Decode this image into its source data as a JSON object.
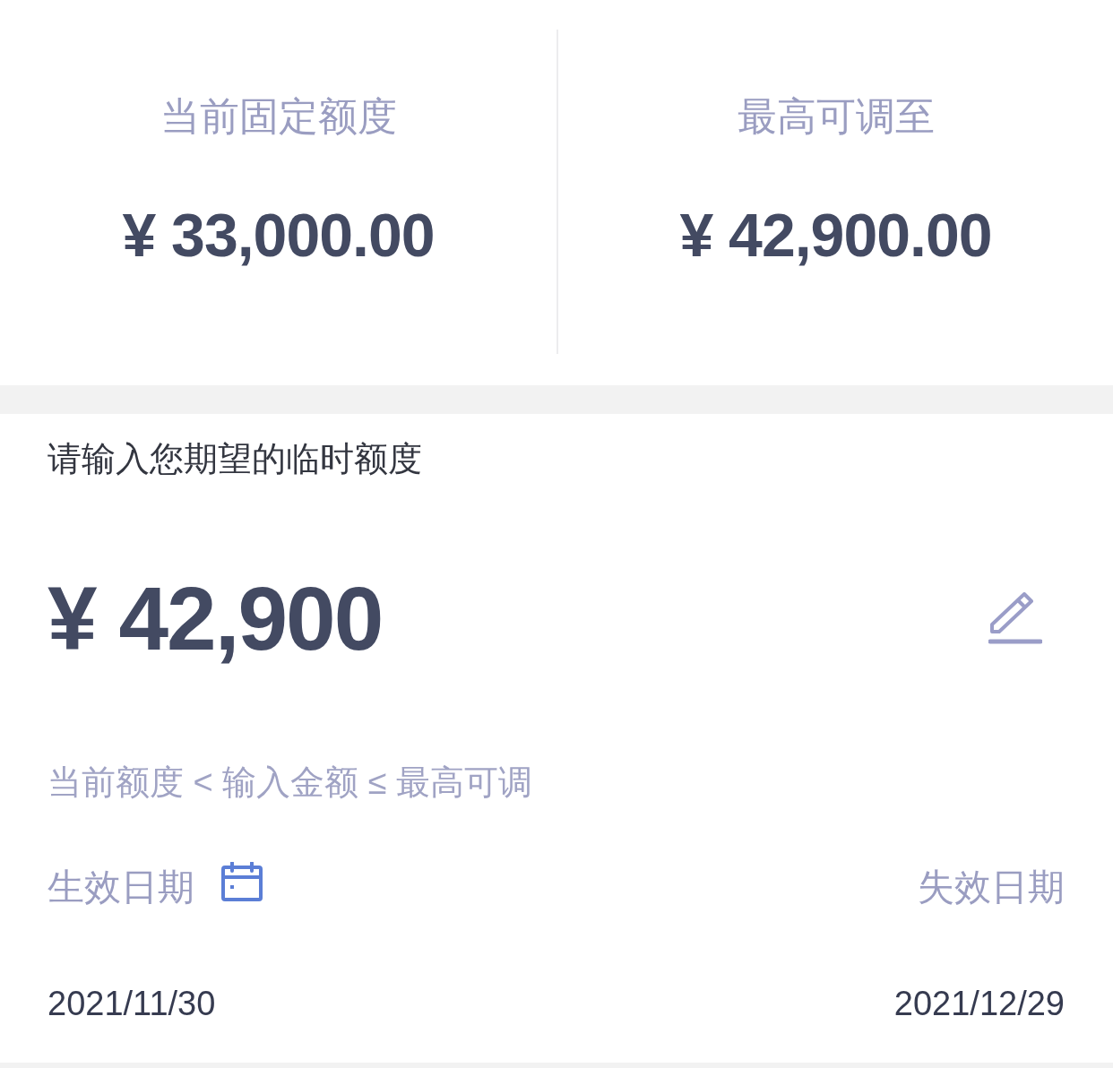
{
  "limits": [
    {
      "label": "当前固定额度",
      "amount": "¥ 33,000.00"
    },
    {
      "label": "最高可调至",
      "amount": "¥ 42,900.00"
    }
  ],
  "amount_input": {
    "label": "请输入您期望的临时额度",
    "value": "¥ 42,900"
  },
  "hint": "当前额度 < 输入金额 ≤ 最高可调",
  "dates": [
    {
      "kind": "start",
      "label": "生效日期",
      "value": "2021/11/30"
    },
    {
      "kind": "end",
      "label": "失效日期",
      "value": "2021/12/29"
    }
  ]
}
